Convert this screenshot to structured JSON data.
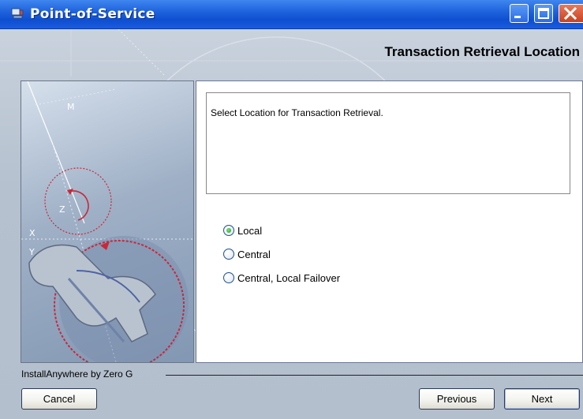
{
  "window": {
    "title": "Point-of-Service"
  },
  "page": {
    "heading": "Transaction Retrieval Location",
    "description": "Select Location for Transaction Retrieval."
  },
  "options": [
    {
      "label": "Local",
      "selected": true
    },
    {
      "label": "Central",
      "selected": false
    },
    {
      "label": "Central, Local Failover",
      "selected": false
    }
  ],
  "footer": {
    "brand": "InstallAnywhere by Zero G",
    "cancel_label": "Cancel",
    "previous_label": "Previous",
    "next_label": "Next"
  },
  "graphic": {
    "axis_labels": [
      "M",
      "Z",
      "X",
      "Y"
    ]
  },
  "colors": {
    "titlebar": "#1f63dd",
    "radio_selected": "#1f9a1f",
    "close_button": "#c8421f"
  }
}
